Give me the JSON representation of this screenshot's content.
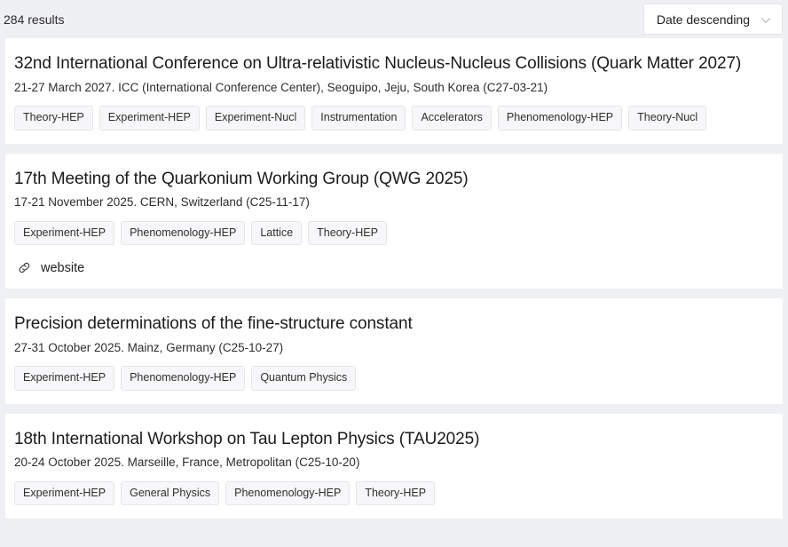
{
  "toolbar": {
    "results_count": "284 results",
    "sort_value": "Date descending",
    "sort_icon": "chevron-down-icon"
  },
  "colors": {
    "page_background": "#eff0f4",
    "card_background": "#ffffff",
    "tag_background": "#f7f7f9",
    "tag_border": "#e6e6ea",
    "text_primary": "#1b1b1b",
    "text_secondary": "#2d2d2d"
  },
  "results": [
    {
      "title": "32nd International Conference on Ultra-relativistic Nucleus-Nucleus Collisions (Quark Matter 2027)",
      "subtitle": "21-27 March 2027. ICC (International Conference Center), Seoguipo, Jeju, South Korea (C27-03-21)",
      "tags": [
        "Theory-HEP",
        "Experiment-HEP",
        "Experiment-Nucl",
        "Instrumentation",
        "Accelerators",
        "Phenomenology-HEP",
        "Theory-Nucl"
      ],
      "link": null
    },
    {
      "title": "17th Meeting of the Quarkonium Working Group (QWG 2025)",
      "subtitle": "17-21 November 2025. CERN, Switzerland (C25-11-17)",
      "tags": [
        "Experiment-HEP",
        "Phenomenology-HEP",
        "Lattice",
        "Theory-HEP"
      ],
      "link": {
        "icon": "link-icon",
        "label": "website"
      }
    },
    {
      "title": "Precision determinations of the fine-structure constant",
      "subtitle": "27-31 October 2025. Mainz, Germany (C25-10-27)",
      "tags": [
        "Experiment-HEP",
        "Phenomenology-HEP",
        "Quantum Physics"
      ],
      "link": null
    },
    {
      "title": "18th International Workshop on Tau Lepton Physics (TAU2025)",
      "subtitle": "20-24 October 2025. Marseille, France, Metropolitan (C25-10-20)",
      "tags": [
        "Experiment-HEP",
        "General Physics",
        "Phenomenology-HEP",
        "Theory-HEP"
      ],
      "link": null
    }
  ]
}
